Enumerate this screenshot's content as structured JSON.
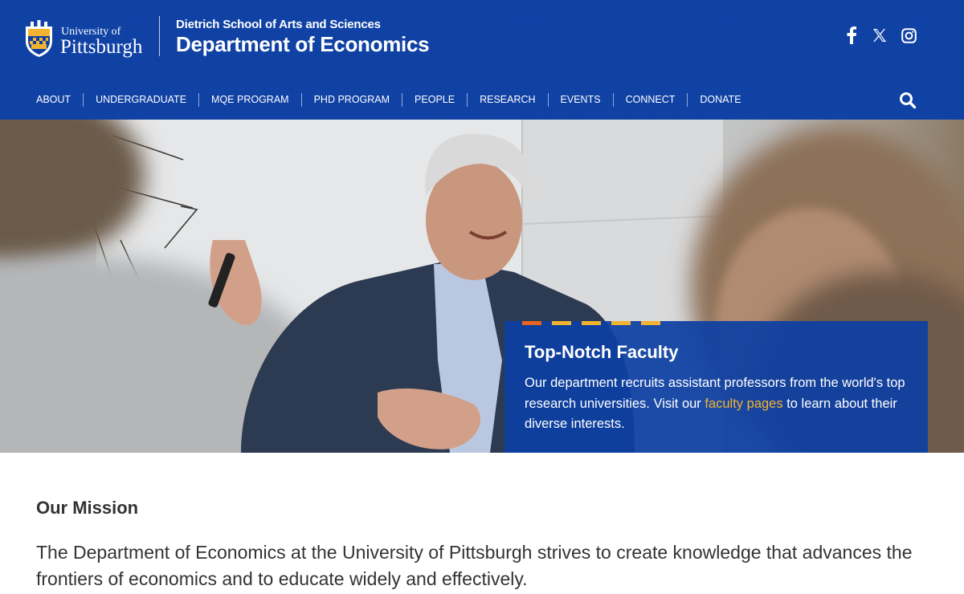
{
  "header": {
    "university_small": "University of",
    "university_big": "Pittsburgh",
    "school": "Dietrich School of Arts and Sciences",
    "department": "Department of Economics",
    "social": [
      {
        "icon": "facebook-icon",
        "glyph": "f"
      },
      {
        "icon": "x-twitter-icon",
        "glyph": "𝕏"
      },
      {
        "icon": "instagram-icon",
        "glyph": ""
      }
    ]
  },
  "nav": {
    "items": [
      "ABOUT",
      "UNDERGRADUATE",
      "MQE PROGRAM",
      "PHD PROGRAM",
      "PEOPLE",
      "RESEARCH",
      "EVENTS",
      "CONNECT",
      "DONATE"
    ],
    "search_icon": "search-icon"
  },
  "hero": {
    "title": "Top-Notch Faculty",
    "text_before": "Our department recruits assistant professors from the world's top research universities. Visit our ",
    "link_text": "faculty pages",
    "text_after": " to learn about their diverse interests.",
    "dash_colors": [
      "#e8641f",
      "#f2b331",
      "#f2b331",
      "#f2b331",
      "#f2b331"
    ]
  },
  "mission": {
    "heading": "Our Mission",
    "body": "The Department of Economics at the University of Pittsburgh strives to create knowledge that advances the frontiers of economics and to educate widely and effectively."
  },
  "colors": {
    "brand_blue": "#0d3fa3",
    "accent_gold": "#f2b331"
  }
}
